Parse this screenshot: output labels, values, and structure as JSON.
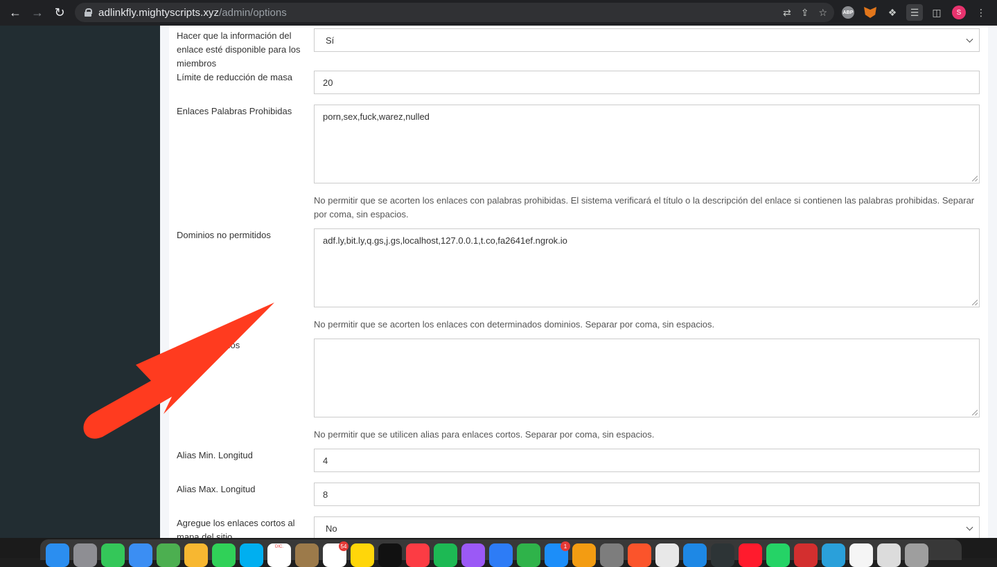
{
  "browser": {
    "url_host": "adlinkfly.mightyscripts.xyz",
    "url_path": "/admin/options",
    "avatar_letter": "S",
    "extensions": [
      "translate-icon",
      "share-icon",
      "star-icon",
      "adblock-plus-icon",
      "metamask-icon",
      "extensions-puzzle-icon",
      "reading-list-icon",
      "side-panel-icon"
    ]
  },
  "form": {
    "link_info": {
      "label": "Hacer que la información del enlace esté disponible para los miembros",
      "value": "Sí"
    },
    "mass_limit": {
      "label": "Límite de reducción de masa",
      "value": "20"
    },
    "banned_words": {
      "label": "Enlaces Palabras Prohibidas",
      "value": "porn,sex,fuck,warez,nulled",
      "help": "No permitir que se acorten los enlaces con palabras prohibidas. El sistema verificará el título o la descripción del enlace si contienen las palabras prohibidas. Separar por coma, sin espacios."
    },
    "banned_domains": {
      "label": "Dominios no permitidos",
      "value": "adf.ly,bit.ly,q.gs,j.gs,localhost,127.0.0.1,t.co,fa2641ef.ngrok.io",
      "help": "No permitir que se acorten los enlaces con determinados dominios. Separar por coma, sin espacios."
    },
    "reserved_aliases": {
      "label_visible": "ervados",
      "value": "",
      "help": "No permitir que se utilicen alias para enlaces cortos. Separar por coma, sin espacios."
    },
    "alias_min": {
      "label": "Alias Min. Longitud",
      "value": "4"
    },
    "alias_max": {
      "label": "Alias Max. Longitud",
      "value": "8"
    },
    "sitemap": {
      "label": "Agregue los enlaces cortos al mapa del sitio",
      "value": "No"
    }
  },
  "colors": {
    "sidebar": "#222d32",
    "arrow": "#ff3b1f",
    "page_bg": "#f4f6f9"
  },
  "dock": {
    "apps": [
      {
        "name": "finder-icon",
        "color": "#2b8ef0"
      },
      {
        "name": "launchpad-icon",
        "color": "#8e8e93"
      },
      {
        "name": "messages-icon",
        "color": "#34c759"
      },
      {
        "name": "mail-icon",
        "color": "#3b8ef3"
      },
      {
        "name": "maps-icon",
        "color": "#4caf50"
      },
      {
        "name": "photos-icon",
        "color": "#f7b731"
      },
      {
        "name": "facetime-icon",
        "color": "#30d158"
      },
      {
        "name": "skype-icon",
        "color": "#00aff0"
      },
      {
        "name": "calendar-icon",
        "color": "#ffffff",
        "badge_text": "DIC."
      },
      {
        "name": "notes-brown-icon",
        "color": "#9c7a4a"
      },
      {
        "name": "reminders-icon",
        "color": "#ffffff",
        "badge": "54"
      },
      {
        "name": "notes-icon",
        "color": "#ffd60a"
      },
      {
        "name": "appletv-icon",
        "color": "#111111"
      },
      {
        "name": "music-icon",
        "color": "#fc3c44"
      },
      {
        "name": "spotify-icon",
        "color": "#1db954"
      },
      {
        "name": "podcasts-icon",
        "color": "#9b59f6"
      },
      {
        "name": "keynote-icon",
        "color": "#2d7cf6"
      },
      {
        "name": "numbers-icon",
        "color": "#2fb34a"
      },
      {
        "name": "appstore-icon",
        "color": "#1c8ef9",
        "badge": "1"
      },
      {
        "name": "pages-icon",
        "color": "#f39c12"
      },
      {
        "name": "system-preferences-icon",
        "color": "#7d7d7d"
      },
      {
        "name": "brave-icon",
        "color": "#fb542b"
      },
      {
        "name": "chrome-icon",
        "color": "#e8e8e8"
      },
      {
        "name": "safari-icon",
        "color": "#1e88e5"
      },
      {
        "name": "git-icon",
        "color": "#2d3436"
      },
      {
        "name": "opera-icon",
        "color": "#ff1b2d"
      },
      {
        "name": "whatsapp-icon",
        "color": "#25d366"
      },
      {
        "name": "acrobat-icon",
        "color": "#d32f2f"
      },
      {
        "name": "telegram-icon",
        "color": "#2aa0da"
      },
      {
        "name": "textedit-icon",
        "color": "#f5f5f5"
      },
      {
        "name": "documents-icon",
        "color": "#dcdcdc"
      },
      {
        "name": "trash-icon",
        "color": "#9e9e9e"
      }
    ]
  }
}
